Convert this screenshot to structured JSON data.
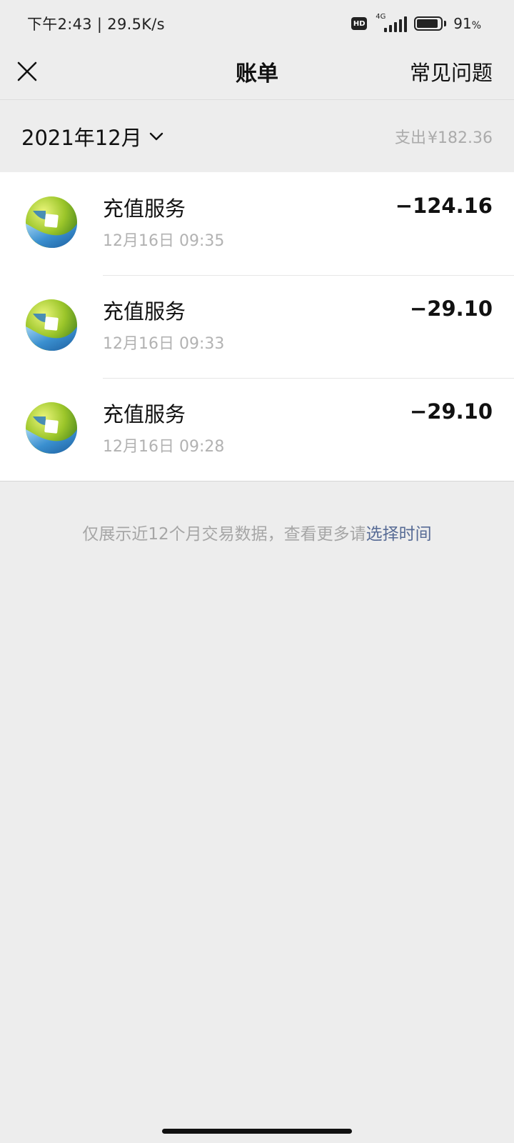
{
  "status_bar": {
    "time_speed": "下午2:43 | 29.5K/s",
    "hd": "HD",
    "network": "4G",
    "battery_level": 0.91,
    "battery_percent": "91",
    "percent_sign": "%"
  },
  "nav": {
    "close_icon": "close-icon",
    "title": "账单",
    "faq_label": "常见问题"
  },
  "month": {
    "label": "2021年12月",
    "expense_label": "支出",
    "expense_amount": "¥182.36"
  },
  "transactions": [
    {
      "title": "充值服务",
      "time": "12月16日 09:35",
      "amount": "−124.16",
      "icon": "merchant-logo-icon"
    },
    {
      "title": "充值服务",
      "time": "12月16日 09:33",
      "amount": "−29.10",
      "icon": "merchant-logo-icon"
    },
    {
      "title": "充值服务",
      "time": "12月16日 09:28",
      "amount": "−29.10",
      "icon": "merchant-logo-icon"
    }
  ],
  "footer": {
    "note": "仅展示近12个月交易数据，查看更多请",
    "link": "选择时间"
  },
  "colors": {
    "background": "#ededed",
    "link": "#576b95",
    "muted": "#b2b2b2"
  }
}
